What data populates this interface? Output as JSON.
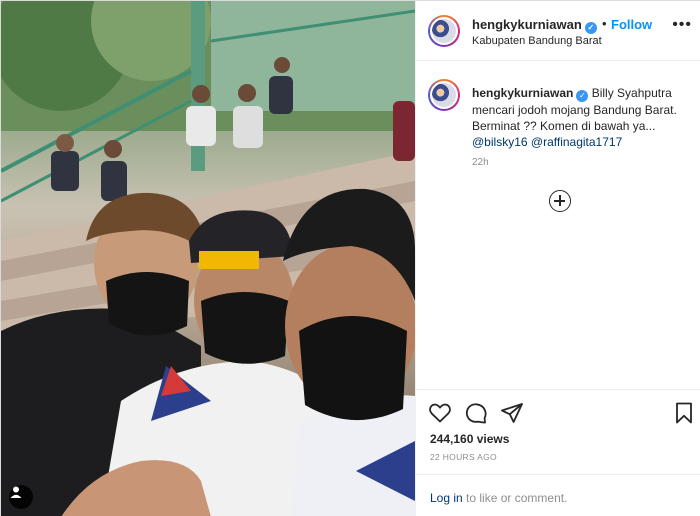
{
  "post": {
    "username": "hengkykurniawan",
    "verified_icon": "verified-badge-icon",
    "separator": "•",
    "follow_label": "Follow",
    "location": "Kabupaten Bandung Barat",
    "more_icon": "more-options-icon"
  },
  "caption": {
    "username": "hengkykurniawan",
    "text": "Billy Syahputra mencari jodoh mojang Bandung Barat. Berminat ?? Komen di bawah ya...",
    "mentions": [
      "@bilsky16",
      "@raffinagita1717"
    ],
    "time": "22h"
  },
  "actions": {
    "like_icon": "heart-icon",
    "comment_icon": "comment-icon",
    "share_icon": "share-icon",
    "save_icon": "bookmark-icon",
    "load_more_icon": "plus-circle-icon"
  },
  "stats": {
    "views": "244,160 views",
    "posted": "22 HOURS AGO"
  },
  "comment": {
    "login_label": "Log in",
    "suffix": " to like or comment."
  },
  "colors": {
    "accent": "#0095f6",
    "link": "#00376b",
    "muted": "#8e8e8e",
    "verified": "#3897f0"
  }
}
